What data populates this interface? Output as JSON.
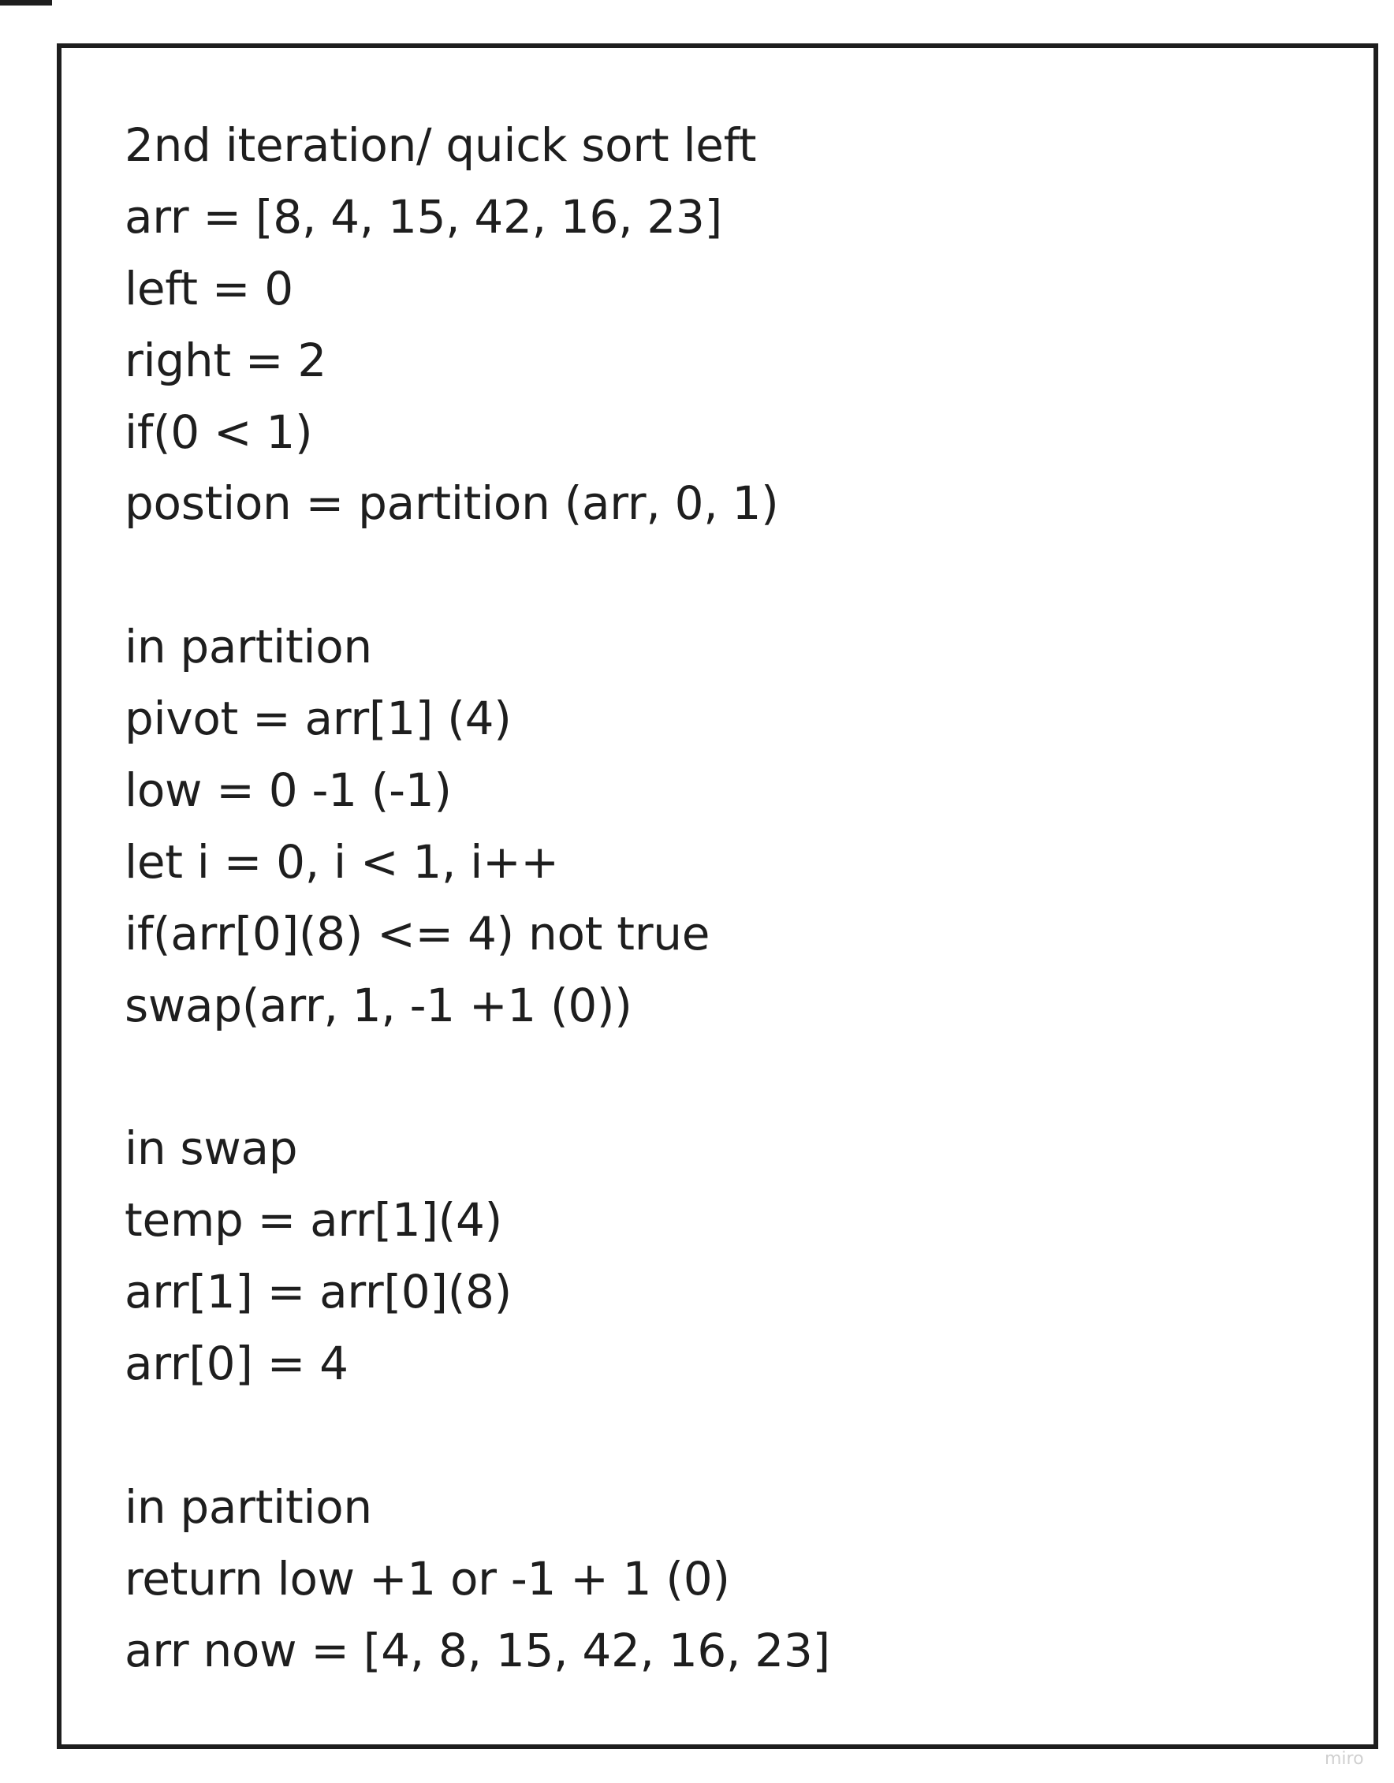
{
  "note": {
    "lines": [
      "2nd iteration/ quick sort left",
      "arr = [8, 4, 15, 42, 16, 23]",
      "left = 0",
      "right = 2",
      "if(0 < 1)",
      "postion = partition (arr, 0, 1)",
      "",
      "in partition",
      "pivot = arr[1] (4)",
      "low = 0 -1 (-1)",
      "let i = 0, i < 1, i++",
      "if(arr[0](8) <= 4) not true",
      "swap(arr, 1, -1 +1 (0))",
      "",
      "in swap",
      "temp = arr[1](4)",
      "arr[1] = arr[0](8)",
      "arr[0] = 4",
      "",
      "in partition",
      "return low +1 or -1 + 1 (0)",
      "arr now = [4, 8, 15, 42, 16, 23]"
    ]
  },
  "watermark": "miro",
  "colors": {
    "text": "#1e1e1e",
    "border": "#1e1e1e",
    "background": "#ffffff"
  }
}
